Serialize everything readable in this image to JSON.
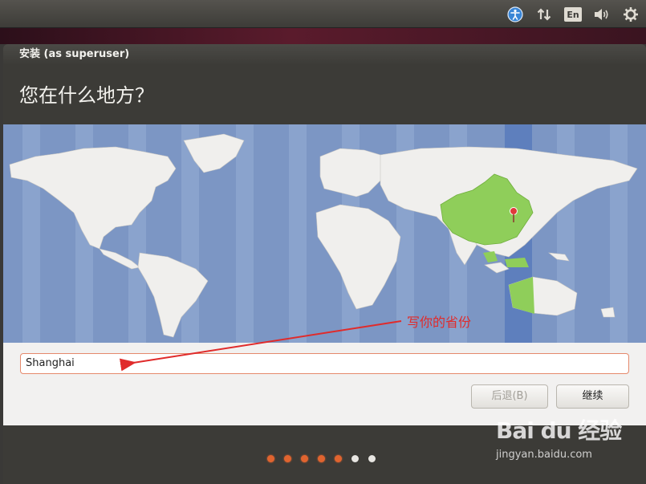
{
  "window": {
    "title": "安装 (as superuser)",
    "heading": "您在什么地方？"
  },
  "topbar": {
    "icons": [
      "accessibility-icon",
      "network-icon",
      "keyboard-layout-indicator",
      "volume-icon",
      "settings-gear-icon"
    ],
    "keyboard_label": "En"
  },
  "location": {
    "city_value": "Shanghai",
    "selected_region": "China"
  },
  "buttons": {
    "back_label": "后退(B)",
    "next_label": "继续"
  },
  "progress": {
    "total_steps": 7,
    "completed_steps": 5
  },
  "annotation": {
    "text": "写你的省份",
    "color": "#e02b2b"
  },
  "watermark": {
    "brand": "Bai du 经验",
    "url": "jingyan.baidu.com"
  },
  "colors": {
    "accent": "#e0642f",
    "selected_country": "#8fce5a",
    "ocean": "#7c96c4",
    "timezone_band": "#5e7fbd"
  }
}
